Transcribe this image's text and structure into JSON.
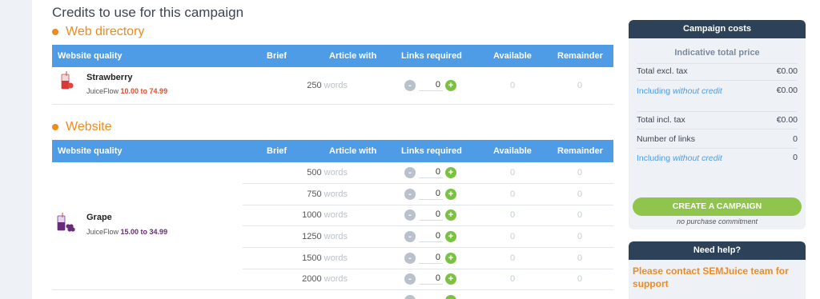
{
  "page_title": "Credits to use for this campaign",
  "columns": {
    "quality": "Website quality",
    "brief": "Brief",
    "article": "Article with",
    "links": "Links required",
    "available": "Available",
    "remainder": "Remainder"
  },
  "sections": [
    {
      "title": "Web directory",
      "product": {
        "name": "Strawberry",
        "brand": "JuiceFlow",
        "price_range": "10.00 to 74.99",
        "icon": "strawberry-juice-icon"
      },
      "rows": [
        {
          "words": "250",
          "unit": "words",
          "qty": "0",
          "available": "0",
          "remainder": "0"
        }
      ]
    },
    {
      "title": "Website",
      "product": {
        "name": "Grape",
        "brand": "JuiceFlow",
        "price_range": "15.00 to 34.99",
        "icon": "grape-juice-icon"
      },
      "rows": [
        {
          "words": "500",
          "unit": "words",
          "qty": "0",
          "available": "0",
          "remainder": "0"
        },
        {
          "words": "750",
          "unit": "words",
          "qty": "0",
          "available": "0",
          "remainder": "0"
        },
        {
          "words": "1000",
          "unit": "words",
          "qty": "0",
          "available": "0",
          "remainder": "0"
        },
        {
          "words": "1250",
          "unit": "words",
          "qty": "0",
          "available": "0",
          "remainder": "0"
        },
        {
          "words": "1500",
          "unit": "words",
          "qty": "0",
          "available": "0",
          "remainder": "0"
        },
        {
          "words": "2000",
          "unit": "words",
          "qty": "0",
          "available": "0",
          "remainder": "0"
        }
      ]
    }
  ],
  "stepper": {
    "minus": "-",
    "plus": "+"
  },
  "cost_panel": {
    "title": "Campaign costs",
    "subtitle": "Indicative total price",
    "total_excl_label": "Total excl. tax",
    "total_excl_value": "€0.00",
    "including_label": "Including",
    "without_credit": "without credit",
    "including_value": "€0.00",
    "total_incl_label": "Total incl. tax",
    "total_incl_value": "€0.00",
    "links_label": "Number of links",
    "links_value": "0",
    "including2_value": "0",
    "create_button": "CREATE A CAMPAIGN",
    "no_commitment": "no purchase commitment"
  },
  "help_panel": {
    "title": "Need help?",
    "text": "Please contact SEMJuice team for support"
  },
  "colors": {
    "accent_orange": "#ee8b1e",
    "header_blue": "#4e9be6",
    "panel_dark": "#2d4158",
    "button_green": "#8fc54d"
  }
}
